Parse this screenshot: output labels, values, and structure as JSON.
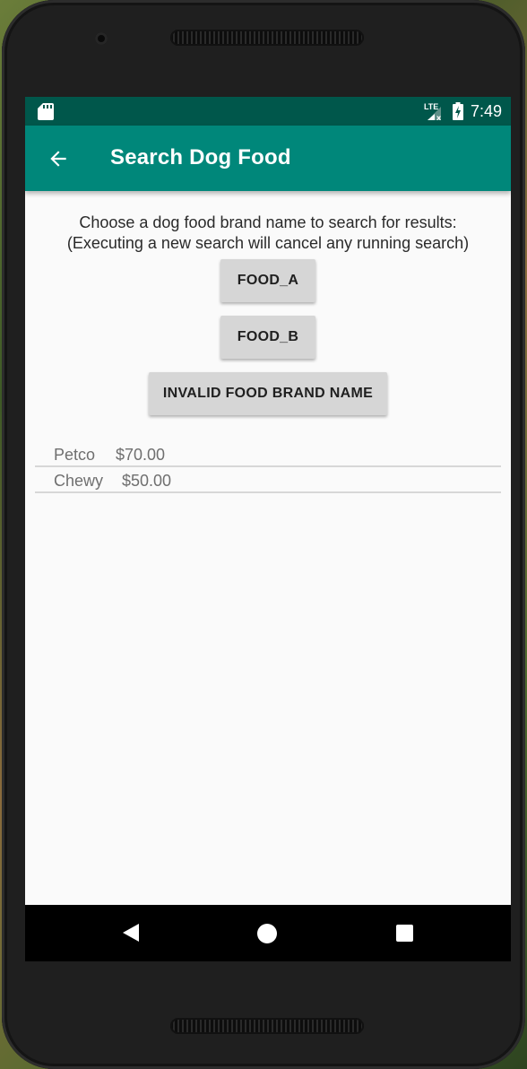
{
  "status_bar": {
    "network": "LTE",
    "time": "7:49"
  },
  "app_bar": {
    "title": "Search Dog Food"
  },
  "instructions": {
    "line1": "Choose a dog food brand name to search for results:",
    "line2": "(Executing a new search will cancel any running search)"
  },
  "buttons": {
    "food_a": "FOOD_A",
    "food_b": "FOOD_B",
    "invalid": "INVALID FOOD BRAND NAME"
  },
  "results": [
    {
      "brand": "Petco",
      "price": "$70.00"
    },
    {
      "brand": "Chewy",
      "price": "$50.00"
    }
  ],
  "colors": {
    "status_bar": "#00574b",
    "app_bar": "#00877a",
    "button": "#d6d6d6"
  },
  "icons": {
    "back": "arrow-left-icon",
    "sd_card": "sd-card-icon",
    "signal": "signal-icon",
    "battery": "battery-icon",
    "nav_back": "triangle-back-icon",
    "nav_home": "circle-home-icon",
    "nav_recents": "square-recents-icon"
  }
}
